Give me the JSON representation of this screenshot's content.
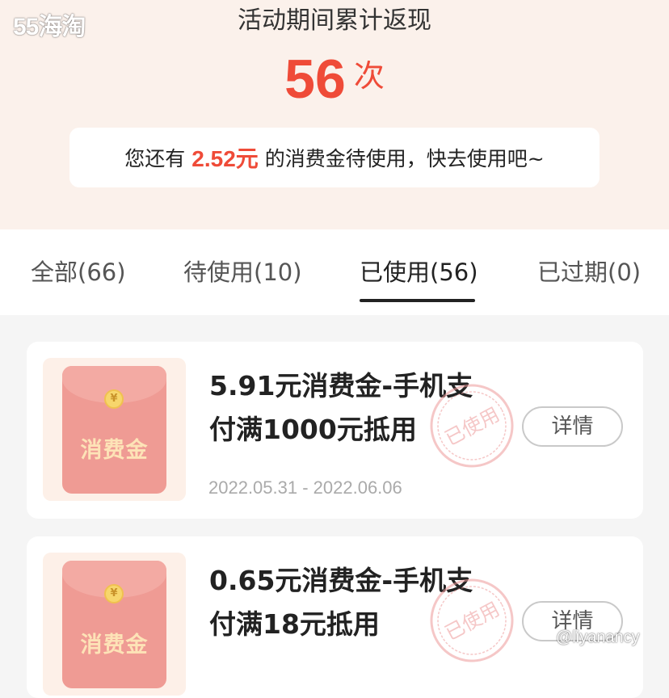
{
  "watermark": {
    "logo_text": "55海淘",
    "user": "@liyanancy"
  },
  "summary": {
    "title": "活动期间累计返现",
    "count": "56",
    "count_unit": "次",
    "notice_prefix": "您还有",
    "notice_amount": "2.52",
    "notice_amount_unit": "元",
    "notice_suffix": "的消费金待使用，快去使用吧~"
  },
  "tabs": [
    {
      "label": "全部(66)",
      "active": false
    },
    {
      "label": "待使用(10)",
      "active": false
    },
    {
      "label": "已使用(56)",
      "active": true
    },
    {
      "label": "已过期(0)",
      "active": false
    }
  ],
  "coupons": [
    {
      "thumb_label": "消费金",
      "coin_symbol": "¥",
      "title_line1": "5.91元消费金-手机支",
      "title_line2": "付满1000元抵用",
      "date_range": "2022.05.31 - 2022.06.06",
      "stamp_text": "已使用",
      "detail_label": "详情"
    },
    {
      "thumb_label": "消费金",
      "coin_symbol": "¥",
      "title_line1": "0.65元消费金-手机支",
      "title_line2": "付满18元抵用",
      "date_range": "",
      "stamp_text": "已使用",
      "detail_label": "详情"
    }
  ],
  "colors": {
    "accent_red": "#ef4b38",
    "header_bg": "#fbf1eb",
    "envelope": "#ef9b94",
    "stamp": "#ee9a9a"
  }
}
